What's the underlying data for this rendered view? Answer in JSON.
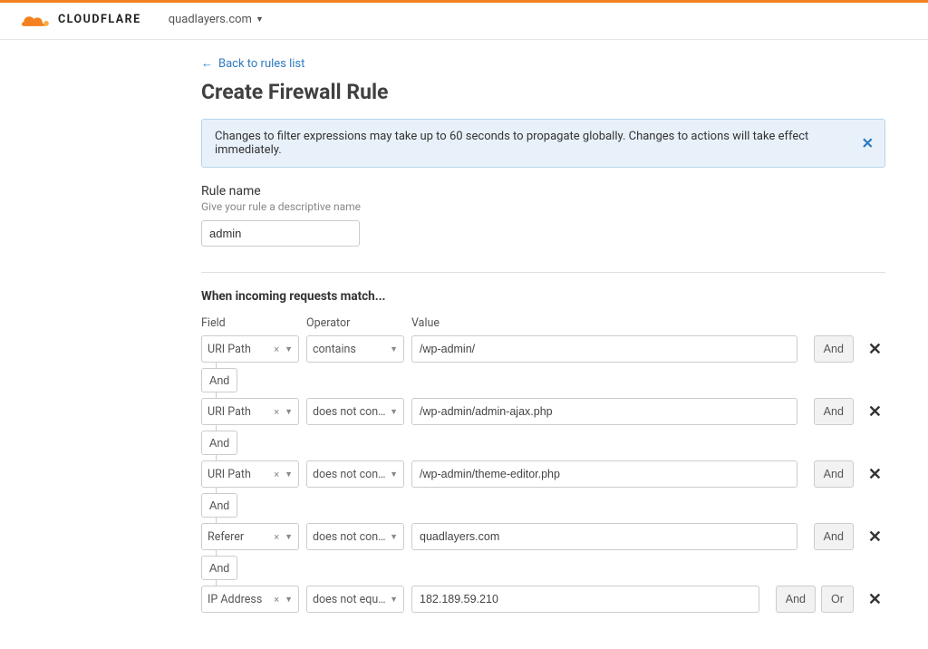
{
  "header": {
    "brand": "CLOUDFLARE",
    "domain": "quadlayers.com"
  },
  "back_link": "Back to rules list",
  "page_title": "Create Firewall Rule",
  "notice": "Changes to filter expressions may take up to 60 seconds to propagate globally. Changes to actions will take effect immediately.",
  "rule_name": {
    "label": "Rule name",
    "help": "Give your rule a descriptive name",
    "value": "admin"
  },
  "match_heading": "When incoming requests match...",
  "col_labels": {
    "field": "Field",
    "operator": "Operator",
    "value": "Value"
  },
  "rules": [
    {
      "field": "URI Path",
      "operator": "contains",
      "value": "/wp-admin/",
      "connector_after": "And",
      "buttons": [
        "And"
      ]
    },
    {
      "field": "URI Path",
      "operator": "does not cont...",
      "value": "/wp-admin/admin-ajax.php",
      "connector_after": "And",
      "buttons": [
        "And"
      ]
    },
    {
      "field": "URI Path",
      "operator": "does not cont...",
      "value": "/wp-admin/theme-editor.php",
      "connector_after": "And",
      "buttons": [
        "And"
      ]
    },
    {
      "field": "Referer",
      "operator": "does not cont...",
      "value": "quadlayers.com",
      "connector_after": "And",
      "buttons": [
        "And"
      ]
    },
    {
      "field": "IP Address",
      "operator": "does not equal",
      "value": "182.189.59.210",
      "connector_after": null,
      "buttons": [
        "And",
        "Or"
      ]
    }
  ],
  "btn_labels": {
    "and": "And",
    "or": "Or"
  }
}
